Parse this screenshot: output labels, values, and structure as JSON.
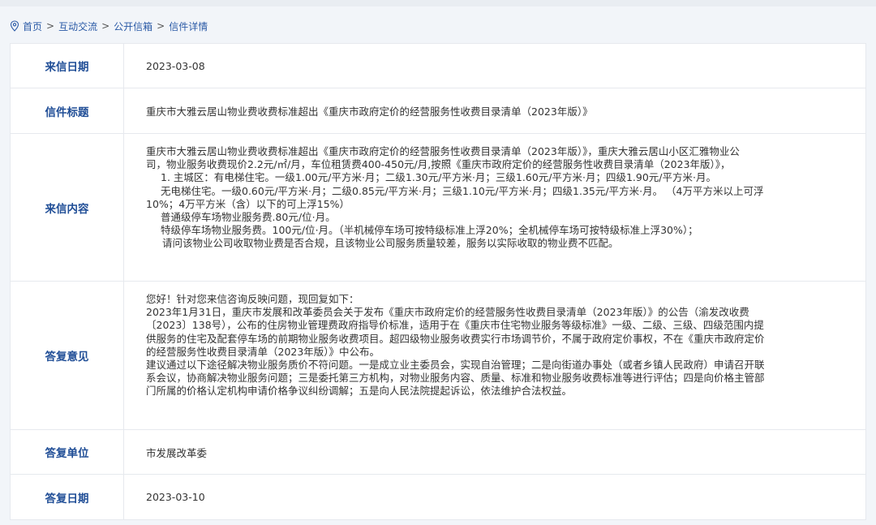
{
  "breadcrumb": {
    "items": [
      "首页",
      "互动交流",
      "公开信箱"
    ],
    "current": "信件详情",
    "separator": ">"
  },
  "labels": {
    "letter_date": "来信日期",
    "letter_title": "信件标题",
    "letter_content": "来信内容",
    "reply_opinion": "答复意见",
    "reply_unit": "答复单位",
    "reply_date": "答复日期"
  },
  "letter": {
    "date": "2023-03-08",
    "title": "重庆市大雅云居山物业费收费标准超出《重庆市政府定价的经营服务性收费目录清单（2023年版）》",
    "content_lines": [
      "重庆市大雅云居山物业费收费标准超出《重庆市政府定价的经营服务性收费目录清单（2023年版）》，重庆大雅云居山小区汇雅物业公",
      "司，物业服务收费现价2.2元/㎡/月，车位租赁费400-450元/月,按照《重庆市政府定价的经营服务性收费目录清单（2023年版）》，",
      "1. 主城区：有电梯住宅。一级1.00元/平方米·月；二级1.30元/平方米·月；三级1.60元/平方米·月；四级1.90元/平方米·月。",
      "无电梯住宅。一级0.60元/平方米·月；二级0.85元/平方米·月；三级1.10元/平方米·月；四级1.35元/平方米·月。 （4万平方米以上可浮",
      "10%；4万平方米（含）以下的可上浮15%）",
      "普通级停车场物业服务费.80元/位·月。",
      "特级停车场物业服务费。100元/位·月。（半机械停车场可按特级标准上浮20%；全机械停车场可按特级标准上浮30%）；",
      "请问该物业公司收取物业费是否合规，且该物业公司服务质量较差，服务以实际收取的物业费不匹配。"
    ]
  },
  "reply": {
    "opinion_lines": [
      "您好！针对您来信咨询反映问题，现回复如下：",
      "2023年1月31日，重庆市发展和改革委员会关于发布《重庆市政府定价的经营服务性收费目录清单（2023年版）》的公告（渝发改收费",
      "〔2023〕138号），公布的住房物业管理费政府指导价标准，适用于在《重庆市住宅物业服务等级标准》一级、二级、三级、四级范围内提",
      "供服务的住宅及配套停车场的前期物业服务收费项目。超四级物业服务收费实行市场调节价，不属于政府定价事权，不在《重庆市政府定价",
      "的经营服务性收费目录清单（2023年版）》中公布。",
      "建议通过以下途径解决物业服务质价不符问题。一是成立业主委员会，实现自治管理；二是向街道办事处（或者乡镇人民政府）申请召开联",
      "系会议，协商解决物业服务问题；三是委托第三方机构，对物业服务内容、质量、标准和物业服务收费标准等进行评估；四是向价格主管部",
      "门所属的价格认定机构申请价格争议纠纷调解；五是向人民法院提起诉讼，依法维护合法权益。"
    ],
    "unit": "市发展改革委",
    "date": "2023-03-10"
  },
  "colors": {
    "label_text": "#1f4d96",
    "link": "#2b5aa6",
    "border": "#e6e9ee",
    "background": "#f2f5f9"
  },
  "icons": {
    "breadcrumb": "location-pin-icon"
  }
}
